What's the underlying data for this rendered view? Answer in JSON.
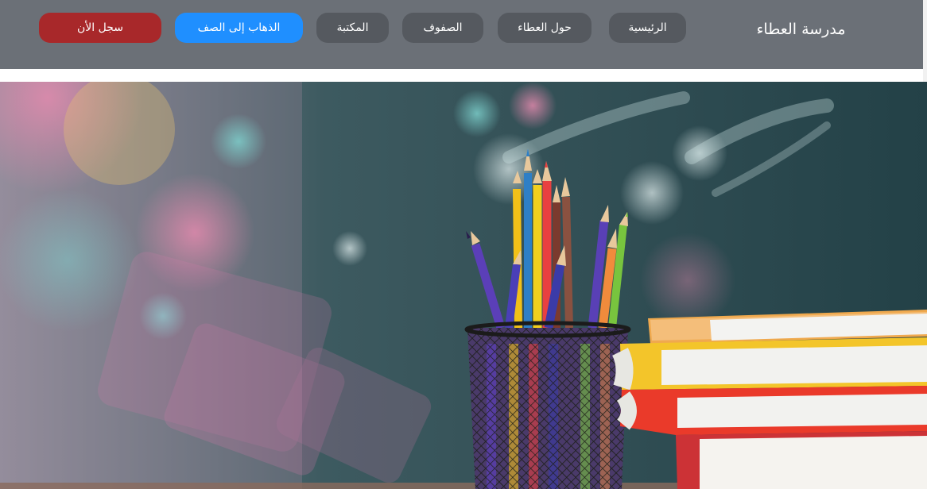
{
  "header": {
    "brand": "مدرسة العطاء",
    "nav": [
      {
        "label": "الرئيسية"
      },
      {
        "label": "حول العطاء"
      },
      {
        "label": "الصفوف"
      },
      {
        "label": "المكتبة"
      }
    ],
    "go_to_class_label": "الذهاب إلى الصف",
    "register_label": "سجل الأن"
  },
  "colors": {
    "navbar": "#6b7077",
    "pill": "#55595f",
    "accent_blue": "#1f8fff",
    "accent_red": "#a8282a"
  }
}
